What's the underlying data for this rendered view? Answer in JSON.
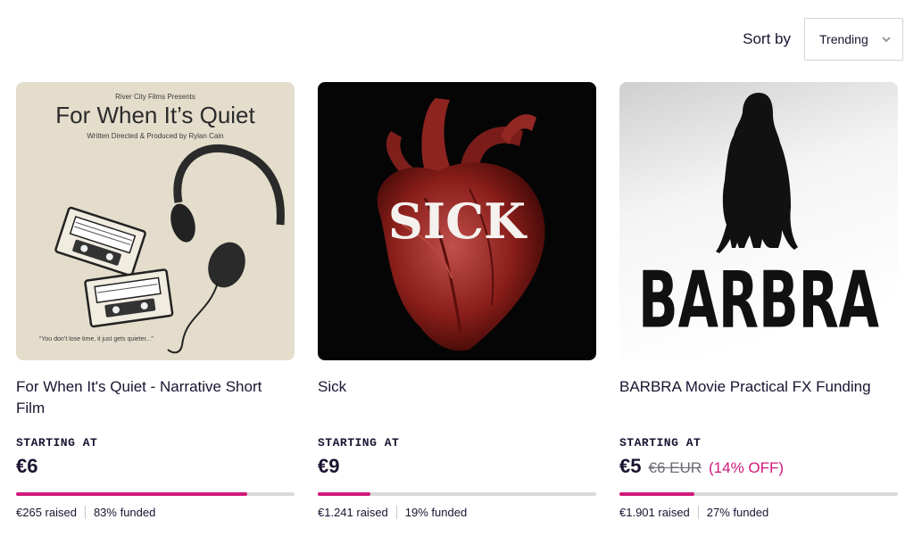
{
  "sort": {
    "label": "Sort by",
    "value": "Trending",
    "icon": "chevron-down-icon"
  },
  "projects": [
    {
      "title": "For When It's Quiet - Narrative Short Film",
      "starting_label": "STARTING AT",
      "price": "€6",
      "old_price": "",
      "discount": "",
      "progress": 0.83,
      "raised": "€265 raised",
      "funded": "83% funded",
      "poster": {
        "presents": "River City Films Presents",
        "title": "For When It’s Quiet",
        "credit": "Written Directed & Produced by Rylan Cain",
        "tagline": "“You don’t lose time, it just gets quieter...”"
      }
    },
    {
      "title": "Sick",
      "starting_label": "STARTING AT",
      "price": "€9",
      "old_price": "",
      "discount": "",
      "progress": 0.19,
      "raised": "€1.241 raised",
      "funded": "19% funded",
      "poster": {
        "title": "SICK"
      }
    },
    {
      "title": "BARBRA Movie Practical FX Funding",
      "starting_label": "STARTING AT",
      "price": "€5",
      "old_price": "€6 EUR",
      "discount": "(14% OFF)",
      "progress": 0.27,
      "raised": "€1.901 raised",
      "funded": "27% funded",
      "poster": {
        "title": "BARBRA"
      }
    }
  ],
  "colors": {
    "accent": "#d0197a",
    "text": "#1b1330",
    "track": "#d9d9dc"
  }
}
